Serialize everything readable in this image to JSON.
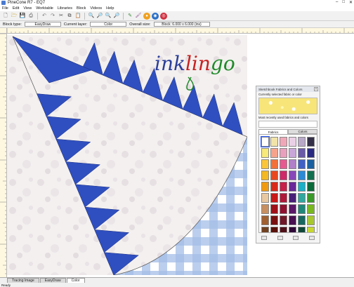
{
  "window": {
    "title": "PineCone R7 - EQ7"
  },
  "menu": [
    "File",
    "Edit",
    "View",
    "Worktable",
    "Libraries",
    "Block",
    "Videos",
    "Help"
  ],
  "toolbar_icons": [
    "new-file-icon",
    "open-file-icon",
    "save-icon",
    "print-icon",
    "undo-icon",
    "redo-icon",
    "cut-icon",
    "copy-icon",
    "paste-icon",
    "zoom-in-icon",
    "zoom-out-icon",
    "zoom-fit-icon",
    "zoom-refresh-icon",
    "edit-block-icon",
    "paintbrush-icon",
    "color-wheel-icon",
    "fabric-color-icon",
    "spraycan-icon"
  ],
  "propbar": {
    "block_type_label": "Block type:",
    "block_type_value": "EasyDraw",
    "current_layer_label": "Current layer:",
    "current_layer_value": "Color",
    "overall_size_label": "Overall size:",
    "overall_size_value": "Block: 6.000 x 6.000 (ins)"
  },
  "logo": {
    "text": "inklingo"
  },
  "panel": {
    "title": "Sketchbook Fabrics and Colors",
    "current_label": "Currently selected fabric or color",
    "recent_label": "Most recently used fabrics and colors",
    "tabs": [
      "Fabrics",
      "Colors"
    ],
    "active_tab": "Fabrics"
  },
  "swatches": [
    "#ffffff",
    "#f2e3a8",
    "#f0a8b8",
    "#ead0e6",
    "#b8a8c8",
    "#343048",
    "#f7e97a",
    "#f6a38c",
    "#e8a0bc",
    "#c8a6d8",
    "#6a5aa8",
    "#2a2a80",
    "#fbc53a",
    "#f2703a",
    "#e85890",
    "#b080c8",
    "#4060c8",
    "#1a60a0",
    "#f4b820",
    "#e84820",
    "#d02868",
    "#8848b8",
    "#2a8ad8",
    "#127050",
    "#f09a10",
    "#d82a1a",
    "#c82048",
    "#6a2898",
    "#1ab0c8",
    "#0a6a3a",
    "#e8c8a0",
    "#c81818",
    "#b0183a",
    "#482078",
    "#30a8a0",
    "#3a9a2a",
    "#c89060",
    "#a01018",
    "#901030",
    "#5a1868",
    "#208878",
    "#78b820",
    "#a06030",
    "#781010",
    "#701828",
    "#481050",
    "#186860",
    "#a8c830",
    "#704020",
    "#581008",
    "#501018",
    "#300838",
    "#104838",
    "#c8d830"
  ],
  "bottom_tabs": [
    "Tracing Image",
    "EasyDraw",
    "Color"
  ],
  "active_bottom_tab": "Color",
  "status": "Ready"
}
